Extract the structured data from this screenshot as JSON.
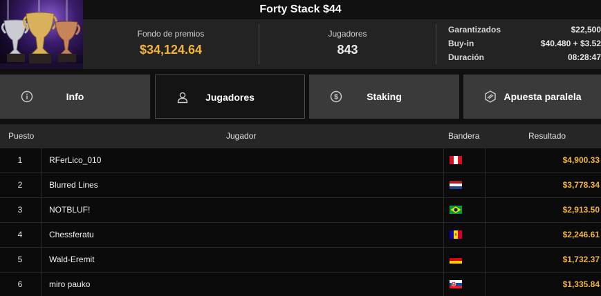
{
  "tournament": {
    "title": "Forty Stack $44",
    "thumbnail": "trophies-image"
  },
  "stats": {
    "prize_label": "Fondo de premios",
    "prize_value": "$34,124.64",
    "players_label": "Jugadores",
    "players_value": "843",
    "guaranteed_label": "Garantizados",
    "guaranteed_value": "$22,500",
    "buyin_label": "Buy-in",
    "buyin_value": "$40.480 + $3.52",
    "duration_label": "Duración",
    "duration_value": "08:28:47"
  },
  "tabs": [
    {
      "label": "Info",
      "icon": "info-icon",
      "active": false
    },
    {
      "label": "Jugadores",
      "icon": "user-icon",
      "active": true
    },
    {
      "label": "Staking",
      "icon": "dollar-coin-icon",
      "active": false
    },
    {
      "label": "Apuesta paralela",
      "icon": "side-bet-icon",
      "active": false
    }
  ],
  "table": {
    "headers": {
      "rank": "Puesto",
      "player": "Jugador",
      "flag": "Bandera",
      "result": "Resultado"
    },
    "rows": [
      {
        "rank": "1",
        "player": "RFerLico_010",
        "flag": "peru-flag",
        "result": "$4,900.33"
      },
      {
        "rank": "2",
        "player": "Blurred Lines",
        "flag": "netherlands-flag",
        "result": "$3,778.34"
      },
      {
        "rank": "3",
        "player": "NOTBLUF!",
        "flag": "brazil-flag",
        "result": "$2,913.50"
      },
      {
        "rank": "4",
        "player": "Chessferatu",
        "flag": "andorra-flag",
        "result": "$2,246.61"
      },
      {
        "rank": "5",
        "player": "Wald-Eremit",
        "flag": "germany-flag",
        "result": "$1,732.37"
      },
      {
        "rank": "6",
        "player": "miro pauko",
        "flag": "slovakia-flag",
        "result": "$1,335.84"
      }
    ]
  },
  "colors": {
    "accent_gold": "#f2b33d",
    "tab_bg": "#3a3a3a",
    "tab_active_bg": "#141414"
  }
}
